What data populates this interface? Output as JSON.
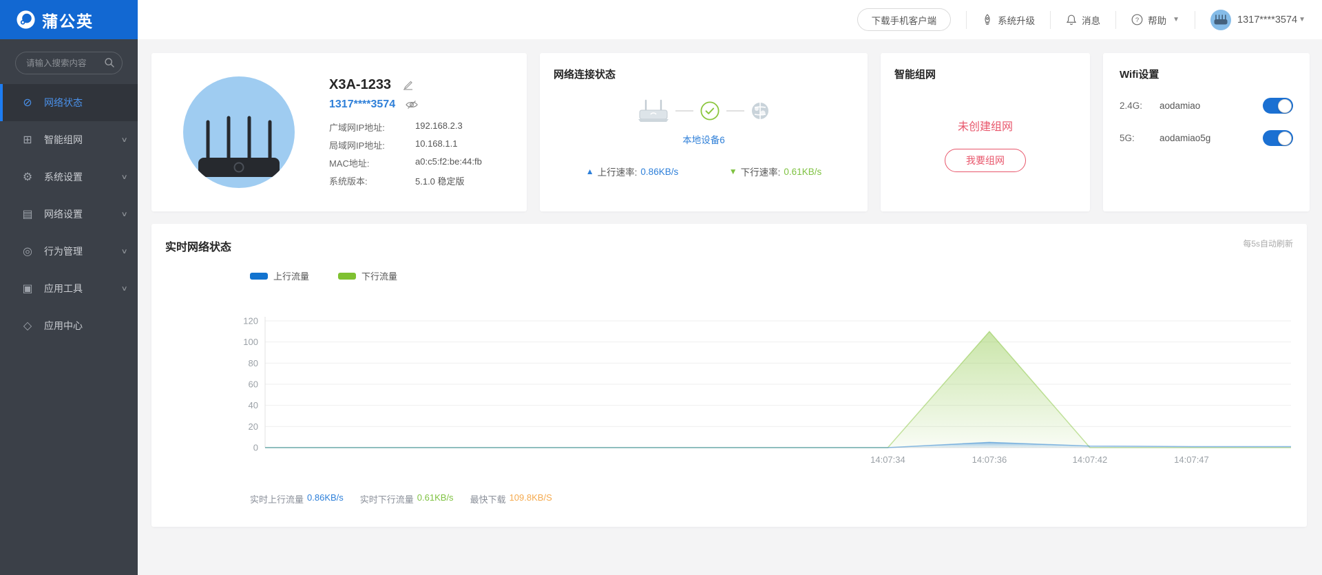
{
  "colors": {
    "brand_blue": "#1268d2",
    "link_blue": "#2e7fd8",
    "success_green": "#7fc131",
    "alert_red": "#e8566b",
    "highlight_orange": "#f5aa4e"
  },
  "header": {
    "logo_text": "蒲公英",
    "download_button": "下载手机客户端",
    "upgrade": "系统升级",
    "messages": "消息",
    "help": "帮助",
    "username": "1317****3574"
  },
  "sidebar": {
    "search_placeholder": "请输入搜索内容",
    "items": [
      {
        "label": "网络状态",
        "icon": "globe",
        "active": true,
        "expandable": false
      },
      {
        "label": "智能组网",
        "icon": "mesh",
        "active": false,
        "expandable": true
      },
      {
        "label": "系统设置",
        "icon": "gear",
        "active": false,
        "expandable": true
      },
      {
        "label": "网络设置",
        "icon": "list",
        "active": false,
        "expandable": true
      },
      {
        "label": "行为管理",
        "icon": "behavior",
        "active": false,
        "expandable": true
      },
      {
        "label": "应用工具",
        "icon": "tools",
        "active": false,
        "expandable": true
      },
      {
        "label": "应用中心",
        "icon": "apps",
        "active": false,
        "expandable": false
      }
    ]
  },
  "device_card": {
    "name": "X3A-1233",
    "account": "1317****3574",
    "rows": [
      {
        "label": "广域网IP地址:",
        "value": "192.168.2.3"
      },
      {
        "label": "局域网IP地址:",
        "value": "10.168.1.1"
      },
      {
        "label": "MAC地址:",
        "value": "a0:c5:f2:be:44:fb"
      },
      {
        "label": "系统版本:",
        "value": "5.1.0 稳定版"
      }
    ]
  },
  "connection_card": {
    "title": "网络连接状态",
    "devices_link": "本地设备6",
    "upload_label": "上行速率:",
    "upload_value": "0.86KB/s",
    "download_label": "下行速率:",
    "download_value": "0.61KB/s"
  },
  "networking_card": {
    "title": "智能组网",
    "status": "未创建组网",
    "button": "我要组网"
  },
  "wifi_card": {
    "title": "Wifi设置",
    "rows": [
      {
        "band": "2.4G:",
        "ssid": "aodamiao",
        "enabled": true
      },
      {
        "band": "5G:",
        "ssid": "aodamiao5g",
        "enabled": true
      }
    ]
  },
  "chart_card": {
    "title": "实时网络状态",
    "refresh_note": "每5s自动刷新",
    "stats": [
      {
        "label": "实时上行流量",
        "value": "0.86KB/s",
        "color": "#2d7fd9"
      },
      {
        "label": "实时下行流量",
        "value": "0.61KB/s",
        "color": "#7fc242"
      },
      {
        "label": "最快下载",
        "value": "109.8KB/S",
        "color": "#f5aa4e"
      }
    ]
  },
  "chart_data": {
    "type": "area",
    "title": "实时网络状态",
    "x": [
      "14:07:34",
      "14:07:36",
      "14:07:42",
      "14:07:47"
    ],
    "series": [
      {
        "name": "上行流量",
        "color": "#1273cf",
        "values": [
          0,
          5,
          1.5,
          1
        ]
      },
      {
        "name": "下行流量",
        "color": "#7fc131",
        "values": [
          0,
          110,
          0,
          0
        ]
      }
    ],
    "ylim": [
      0,
      120
    ],
    "yticks": [
      0,
      20,
      40,
      60,
      80,
      100,
      120
    ],
    "x_tick_fractions": [
      0.607,
      0.706,
      0.804,
      0.903
    ],
    "grid": true,
    "legend_position": "top-left"
  }
}
